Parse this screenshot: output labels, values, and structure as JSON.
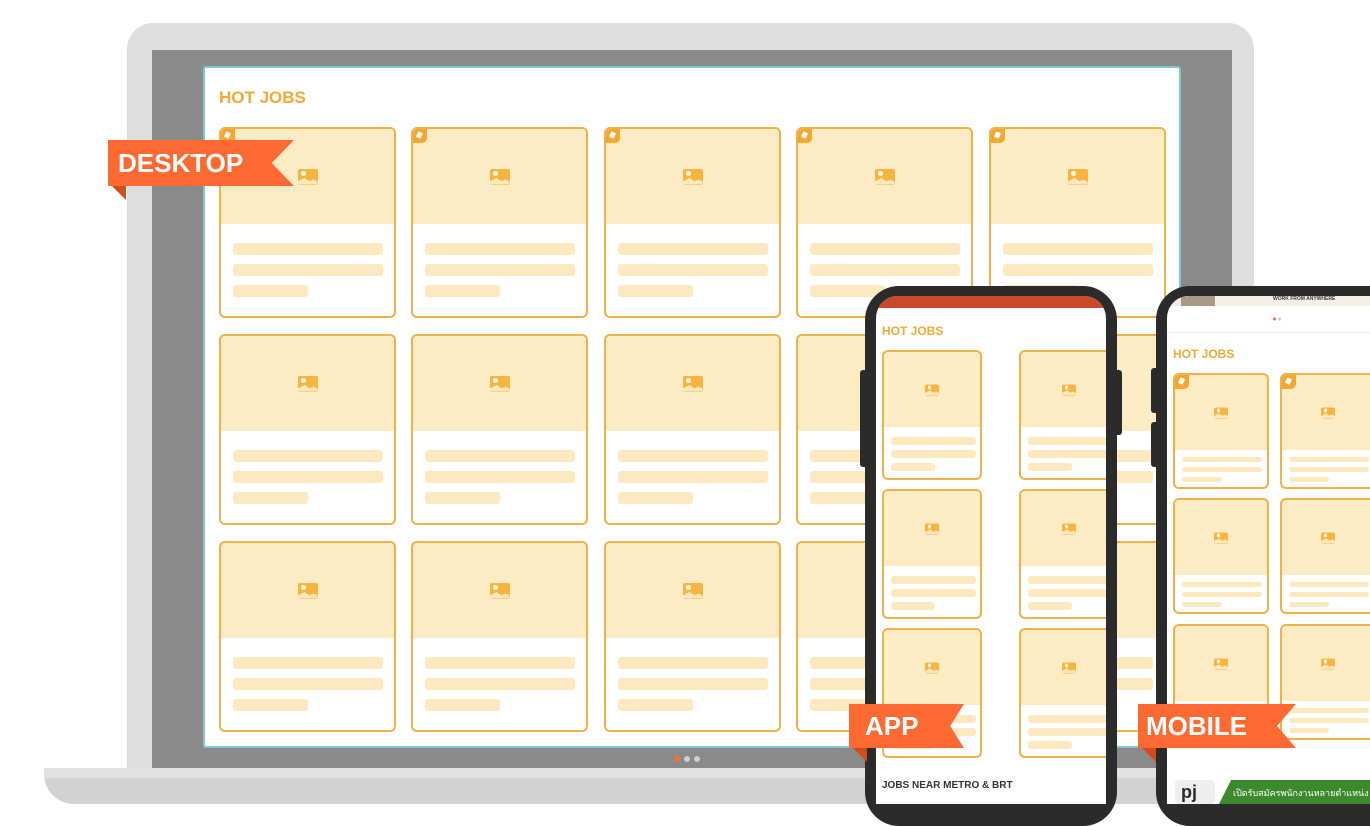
{
  "desktop": {
    "label": "DESKTOP",
    "section_title": "HOT JOBS"
  },
  "app": {
    "label": "APP",
    "section_title": "HOT JOBS",
    "bottom_section_title": "JOBS NEAR METRO & BRT"
  },
  "mobile": {
    "label": "MOBILE",
    "banner_text": "WORK FROM ANYWHERE",
    "section_title": "HOT JOBS",
    "footer_logo": "pj",
    "footer_banner_text": "เปิดรับสมัครพนักงานหลายตำแหน่ง"
  },
  "colors": {
    "accent": "#f4a934",
    "card_border": "#f1b14a",
    "placeholder": "#fdebc4",
    "tag": "#ff6a33"
  }
}
